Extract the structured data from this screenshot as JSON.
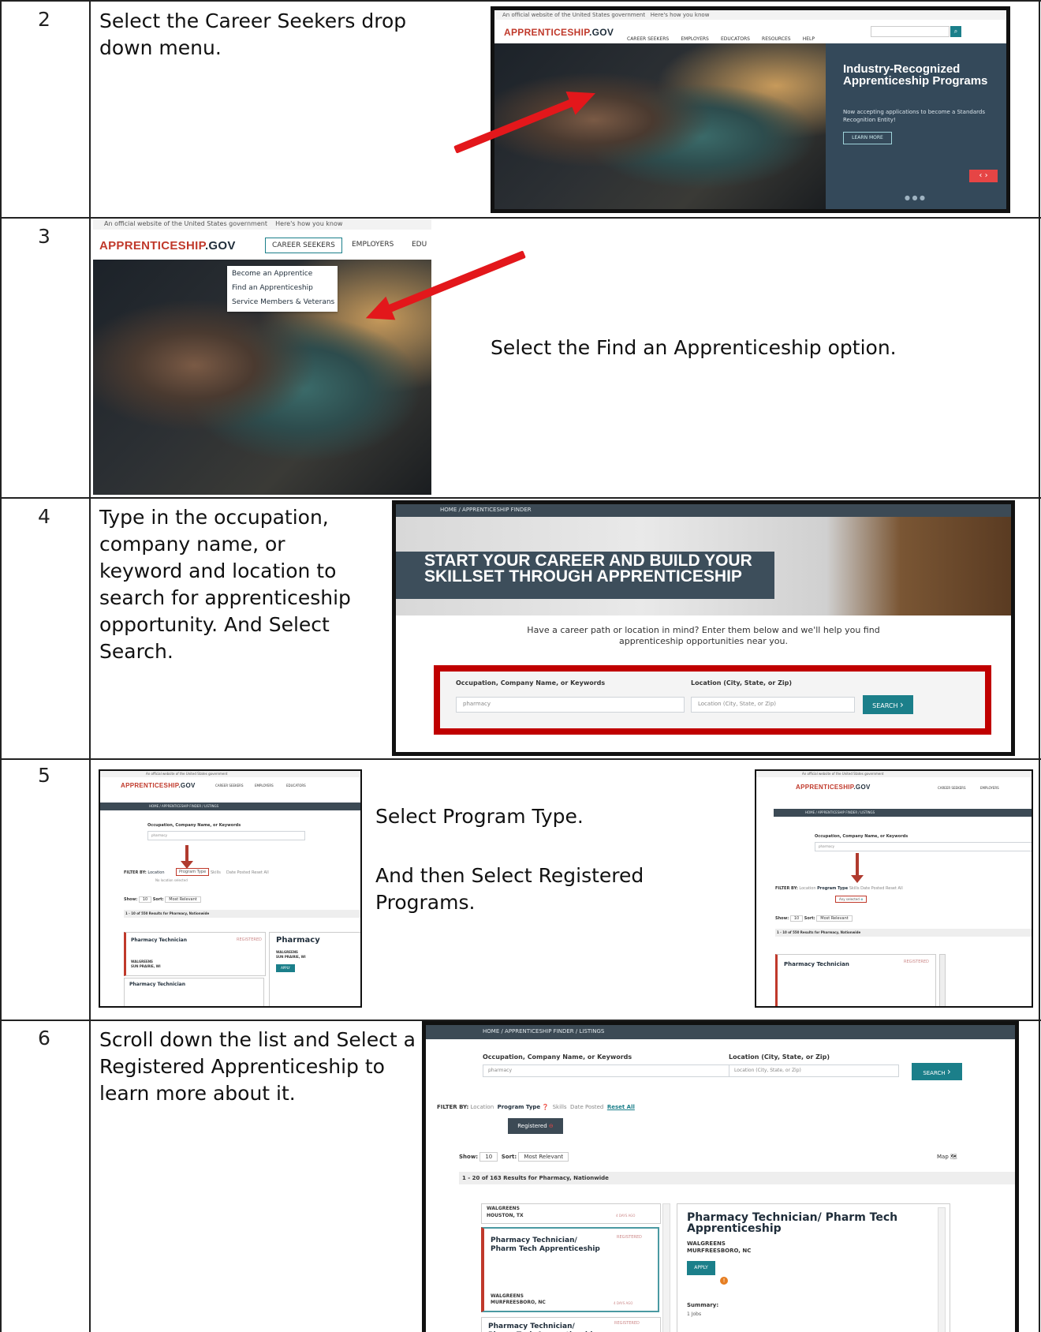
{
  "rows": [
    {
      "number": "2",
      "text": "Select the Career Seekers drop down menu."
    },
    {
      "number": "3",
      "text": "Select the Find an Apprenticeship option."
    },
    {
      "number": "4",
      "text": "Type in the occupation, company name, or keyword and location to search for apprenticeship opportunity. And Select Search."
    },
    {
      "number": "5",
      "text_a": "Select Program Type.",
      "text_b": "And then Select Registered Programs."
    },
    {
      "number": "6",
      "text": "Scroll down the list and Select a Registered Apprenticeship to learn more about it."
    }
  ],
  "site": {
    "official_notice": "An official website of the United States government",
    "how_you_know": "Here's how you know",
    "logo_main": "APPRENTICESHIP",
    "logo_suffix": ".GOV",
    "nav": [
      "CAREER SEEKERS",
      "EMPLOYERS",
      "EDUCATORS",
      "RESOURCES",
      "HELP"
    ],
    "nav_short_edu": "EDU"
  },
  "hero": {
    "title": "Industry-Recognized Apprenticeship Programs",
    "subtitle": "Now accepting applications to become a Standards Recognition Entity!",
    "button": "LEARN MORE"
  },
  "dropdown": {
    "items": [
      "Become an Apprentice",
      "Find an Apprenticeship",
      "Service Members & Veterans"
    ]
  },
  "finder": {
    "breadcrumb": "HOME / APPRENTICESHIP FINDER",
    "banner": "START YOUR CAREER AND BUILD YOUR SKILLSET THROUGH APPRENTICESHIP",
    "intro": "Have a career path or location in mind? Enter them below and we'll help you find apprenticeship opportunities near you.",
    "occupation_label": "Occupation, Company Name, or Keywords",
    "occupation_value": "pharmacy",
    "location_label": "Location (City, State, or Zip)",
    "location_placeholder": "Location (City, State, or Zip)",
    "search_button": "SEARCH"
  },
  "listings": {
    "breadcrumb": "HOME / APPRENTICESHIP FINDER / LISTINGS",
    "filter_label": "FILTER BY:",
    "filters": [
      "Location",
      "Program Type",
      "Skills",
      "Date Posted"
    ],
    "reset": "Reset All",
    "no_location": "No location selected",
    "any_selected": "Any selected",
    "show_label": "Show:",
    "show_value": "10",
    "sort_label": "Sort:",
    "sort_value": "Most Relevant",
    "results_550": "1 - 10 of 550 Results for Pharmacy, Nationwide",
    "results_163": "1 - 20 of 163 Results for Pharmacy, Nationwide",
    "registered_chip": "Registered",
    "map_label": "Map",
    "job_title": "Pharmacy Technician",
    "job_company": "WALGREENS",
    "job_location_sp": "SUN PRAIRIE, WI",
    "registered_tag": "REGISTERED",
    "apply": "APPLY",
    "pharm_short": "Pharmacy",
    "prev_company": "WALGREENS",
    "prev_location": "HOUSTON, TX",
    "card_title": "Pharmacy Technician/ Pharm Tech Apprenticeship",
    "card_company": "WALGREENS",
    "card_location": "MURFREESBORO, NC",
    "days_ago": "4 DAYS AGO",
    "next_title": "Pharmacy Technician/ Pharm Tech Apprenticeship",
    "detail_title": "Pharmacy Technician/ Pharm Tech Apprenticeship",
    "summary_label": "Summary:",
    "summary_value": "1 Jobs"
  }
}
